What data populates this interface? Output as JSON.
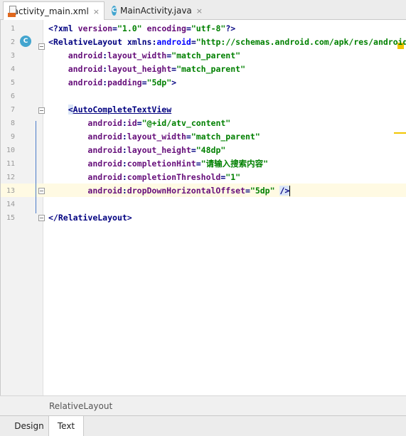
{
  "tabs": [
    {
      "label": "activity_main.xml",
      "close": "×"
    },
    {
      "label": "MainActivity.java",
      "close": "×"
    }
  ],
  "gutter_icon": "C",
  "line_numbers": [
    "1",
    "2",
    "3",
    "4",
    "5",
    "6",
    "7",
    "8",
    "9",
    "10",
    "11",
    "12",
    "13",
    "14",
    "15"
  ],
  "code": {
    "l1": {
      "open": "<?",
      "name": "xml",
      "a1": "version",
      "v1": "\"1.0\"",
      "a2": "encoding",
      "v2": "\"utf-8\"",
      "close": "?>"
    },
    "l2": {
      "open": "<",
      "tag": "RelativeLayout",
      "attr": "xmlns",
      "ns": "android",
      "val": "\"http://schemas.android.com/apk/res/android\""
    },
    "l3": {
      "ns": "android",
      "attr": "layout_width",
      "val": "\"match_parent\""
    },
    "l4": {
      "ns": "android",
      "attr": "layout_height",
      "val": "\"match_parent\""
    },
    "l5": {
      "ns": "android",
      "attr": "padding",
      "val": "\"5dp\"",
      "close": ">"
    },
    "l7": {
      "open": "<",
      "tag": "AutoCompleteTextView"
    },
    "l8": {
      "ns": "android",
      "attr": "id",
      "val": "\"@+id/atv_content\""
    },
    "l9": {
      "ns": "android",
      "attr": "layout_width",
      "val": "\"match_parent\""
    },
    "l10": {
      "ns": "android",
      "attr": "layout_height",
      "val": "\"48dp\""
    },
    "l11": {
      "ns": "android",
      "attr": "completionHint",
      "val": "\"请输入搜索内容\""
    },
    "l12": {
      "ns": "android",
      "attr": "completionThreshold",
      "val": "\"1\""
    },
    "l13": {
      "ns": "android",
      "attr": "dropDownHorizontalOffset",
      "val": "\"5dp\"",
      "close": "/>"
    },
    "l15": {
      "open": "</",
      "tag": "RelativeLayout",
      "close": ">"
    }
  },
  "breadcrumb": "RelativeLayout",
  "bottom_tabs": [
    "Design",
    "Text"
  ],
  "colors": {
    "tag": "#000080",
    "attr": "#660e7a",
    "value": "#008000",
    "namespace": "#0000ff",
    "current_line": "#fffae3",
    "marker": "#f2c500",
    "class_icon": "#43a5cf"
  }
}
